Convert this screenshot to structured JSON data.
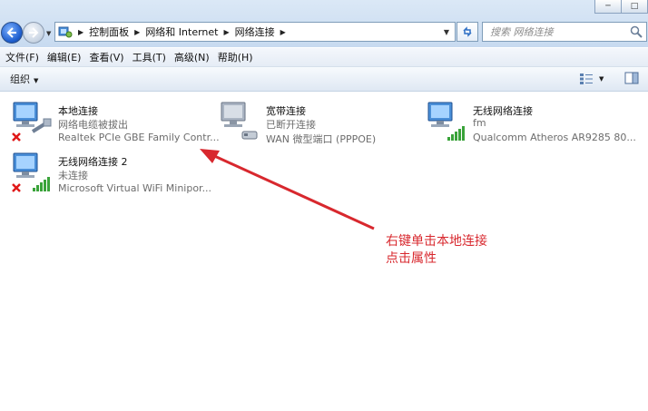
{
  "window": {
    "minimize_glyph": "─",
    "maximize_glyph": "□"
  },
  "address": {
    "breadcrumbs": [
      "控制面板",
      "网络和 Internet",
      "网络连接"
    ],
    "search_placeholder": "搜索 网络连接"
  },
  "menu": [
    {
      "label": "文件(F)"
    },
    {
      "label": "编辑(E)"
    },
    {
      "label": "查看(V)"
    },
    {
      "label": "工具(T)"
    },
    {
      "label": "高级(N)"
    },
    {
      "label": "帮助(H)"
    }
  ],
  "toolbar": {
    "organize_label": "组织"
  },
  "connections": [
    {
      "name": "本地连接",
      "status": "网络电缆被拔出",
      "device": "Realtek PCIe GBE Family Contr...",
      "kind": "ethernet",
      "error": true
    },
    {
      "name": "宽带连接",
      "status": "已断开连接",
      "device": "WAN 微型端口 (PPPOE)",
      "kind": "broadband",
      "error": false
    },
    {
      "name": "无线网络连接",
      "status": "fm",
      "device": "Qualcomm Atheros AR9285 80...",
      "kind": "wireless",
      "error": false
    },
    {
      "name": "无线网络连接 2",
      "status": "未连接",
      "device": "Microsoft Virtual WiFi Minipor...",
      "kind": "wireless",
      "error": true
    }
  ],
  "annotation": {
    "line1": "右键单击本地连接",
    "line2": "点击属性",
    "color": "#d8282e"
  }
}
